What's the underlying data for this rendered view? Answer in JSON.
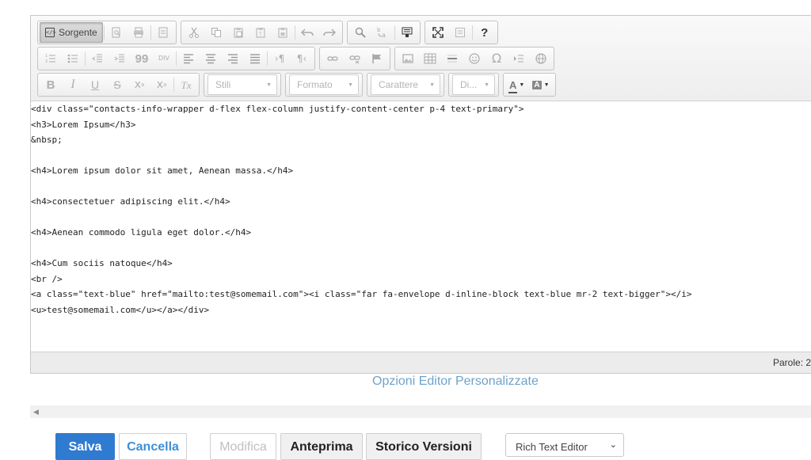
{
  "toolbar": {
    "source_label": "Sorgente",
    "combos": {
      "styles": "Stili",
      "format": "Formato",
      "font": "Carattere",
      "size": "Di..."
    },
    "icons": {
      "help": "?",
      "subscript": "x",
      "superscript": "x",
      "blockquote": "99",
      "div": "DIV",
      "omega": "Ω",
      "text_color": "A",
      "bg_color": "A",
      "bold": "B",
      "italic": "I",
      "underline": "U",
      "strike": "S",
      "remove_format": "Tx"
    }
  },
  "code_lines": [
    "<div class=\"contacts-info-wrapper d-flex flex-column justify-content-center p-4 text-primary\">",
    "<h3>Lorem Ipsum</h3>",
    "&nbsp;",
    "",
    "<h4>Lorem ipsum dolor sit amet, Aenean massa.</h4>",
    "",
    "<h4>consectetuer adipiscing elit.</h4>",
    "",
    "<h4>Aenean commodo ligula eget dolor.</h4>",
    "",
    "<h4>Cum sociis natoque</h4>",
    "<br />",
    "<a class=\"text-blue\" href=\"mailto:test@somemail.com\"><i class=\"far fa-envelope d-inline-block text-blue mr-2 text-bigger\"></i>",
    "<u>test@somemail.com</u></a></div>"
  ],
  "status": {
    "word_count": "Parole: 2"
  },
  "custom_options_link": "Opzioni Editor Personalizzate",
  "actions": {
    "save": "Salva",
    "cancel": "Cancella",
    "modify": "Modifica",
    "preview": "Anteprima",
    "history": "Storico Versioni"
  },
  "editor_select": {
    "value": "Rich Text Editor"
  },
  "colors": {
    "primary_button": "#2f7bd1",
    "link": "#6fa3c9",
    "toolbar_bg": "#eeeeee",
    "status_bar": "#ececec"
  }
}
